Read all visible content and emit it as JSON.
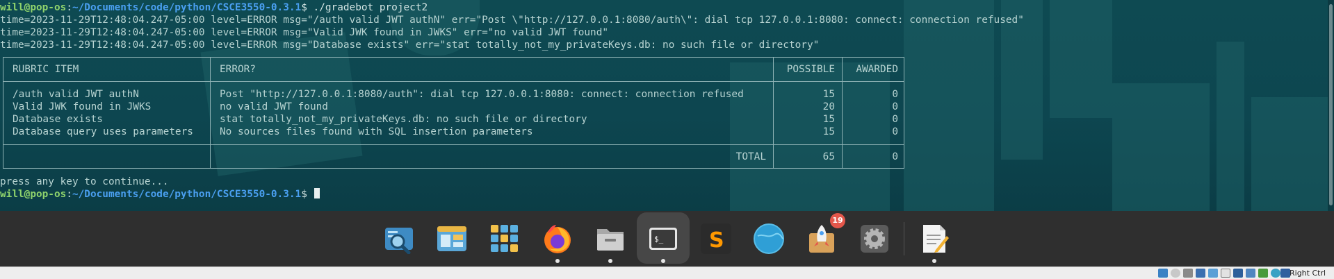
{
  "terminal": {
    "prompt_user": "will@pop-os",
    "prompt_sep": ":",
    "prompt_path": "~/Documents/code/python/CSCE3550-0.3.1",
    "prompt_dollar": "$ ",
    "command": "./gradebot project2",
    "log_lines": [
      "time=2023-11-29T12:48:04.247-05:00 level=ERROR msg=\"/auth valid JWT authN\" err=\"Post \\\"http://127.0.0.1:8080/auth\\\": dial tcp 127.0.0.1:8080: connect: connection refused\"",
      "time=2023-11-29T12:48:04.247-05:00 level=ERROR msg=\"Valid JWK found in JWKS\" err=\"no valid JWT found\"",
      "time=2023-11-29T12:48:04.247-05:00 level=ERROR msg=\"Database exists\" err=\"stat totally_not_my_privateKeys.db: no such file or directory\""
    ],
    "table": {
      "headers": {
        "item": "RUBRIC ITEM",
        "error": "ERROR?",
        "possible": "POSSIBLE",
        "awarded": "AWARDED"
      },
      "rows": [
        {
          "item": "/auth valid JWT authN",
          "error": "Post \"http://127.0.0.1:8080/auth\": dial tcp 127.0.0.1:8080: connect: connection refused",
          "possible": "15",
          "awarded": "0"
        },
        {
          "item": "Valid JWK found in JWKS",
          "error": "no valid JWT found",
          "possible": "20",
          "awarded": "0"
        },
        {
          "item": "Database exists",
          "error": "stat totally_not_my_privateKeys.db: no such file or directory",
          "possible": "15",
          "awarded": "0"
        },
        {
          "item": "Database query uses parameters",
          "error": "No sources files found with SQL insertion parameters",
          "possible": "15",
          "awarded": "0"
        }
      ],
      "total_label": "TOTAL",
      "total_possible": "65",
      "total_awarded": "0"
    },
    "continue_text": "press any key to continue..."
  },
  "dock": {
    "items": [
      {
        "name": "search-app",
        "icon": "magnifier-icon"
      },
      {
        "name": "files-manager",
        "icon": "window-icon"
      },
      {
        "name": "app-library",
        "icon": "grid-icon"
      },
      {
        "name": "firefox",
        "icon": "firefox-icon"
      },
      {
        "name": "files",
        "icon": "folder-icon"
      },
      {
        "name": "terminal",
        "icon": "terminal-icon",
        "terminal_glyph": "$_"
      },
      {
        "name": "sublime-text",
        "icon": "sublime-icon",
        "glyph": "S"
      },
      {
        "name": "browser",
        "icon": "globe-icon"
      },
      {
        "name": "pop-shop",
        "icon": "rocket-icon",
        "badge": "19"
      },
      {
        "name": "settings",
        "icon": "gear-icon"
      },
      {
        "name": "text-editor",
        "icon": "notepad-icon"
      }
    ]
  },
  "status_bar": {
    "host_key": "Right Ctrl"
  },
  "colors": {
    "terminal_bg": "#0e4a52",
    "prompt_user": "#8fd36c",
    "prompt_path": "#4a9ff0",
    "text": "#b7d3d1",
    "dock_bg": "#2f2f2f",
    "badge": "#e4574b"
  }
}
